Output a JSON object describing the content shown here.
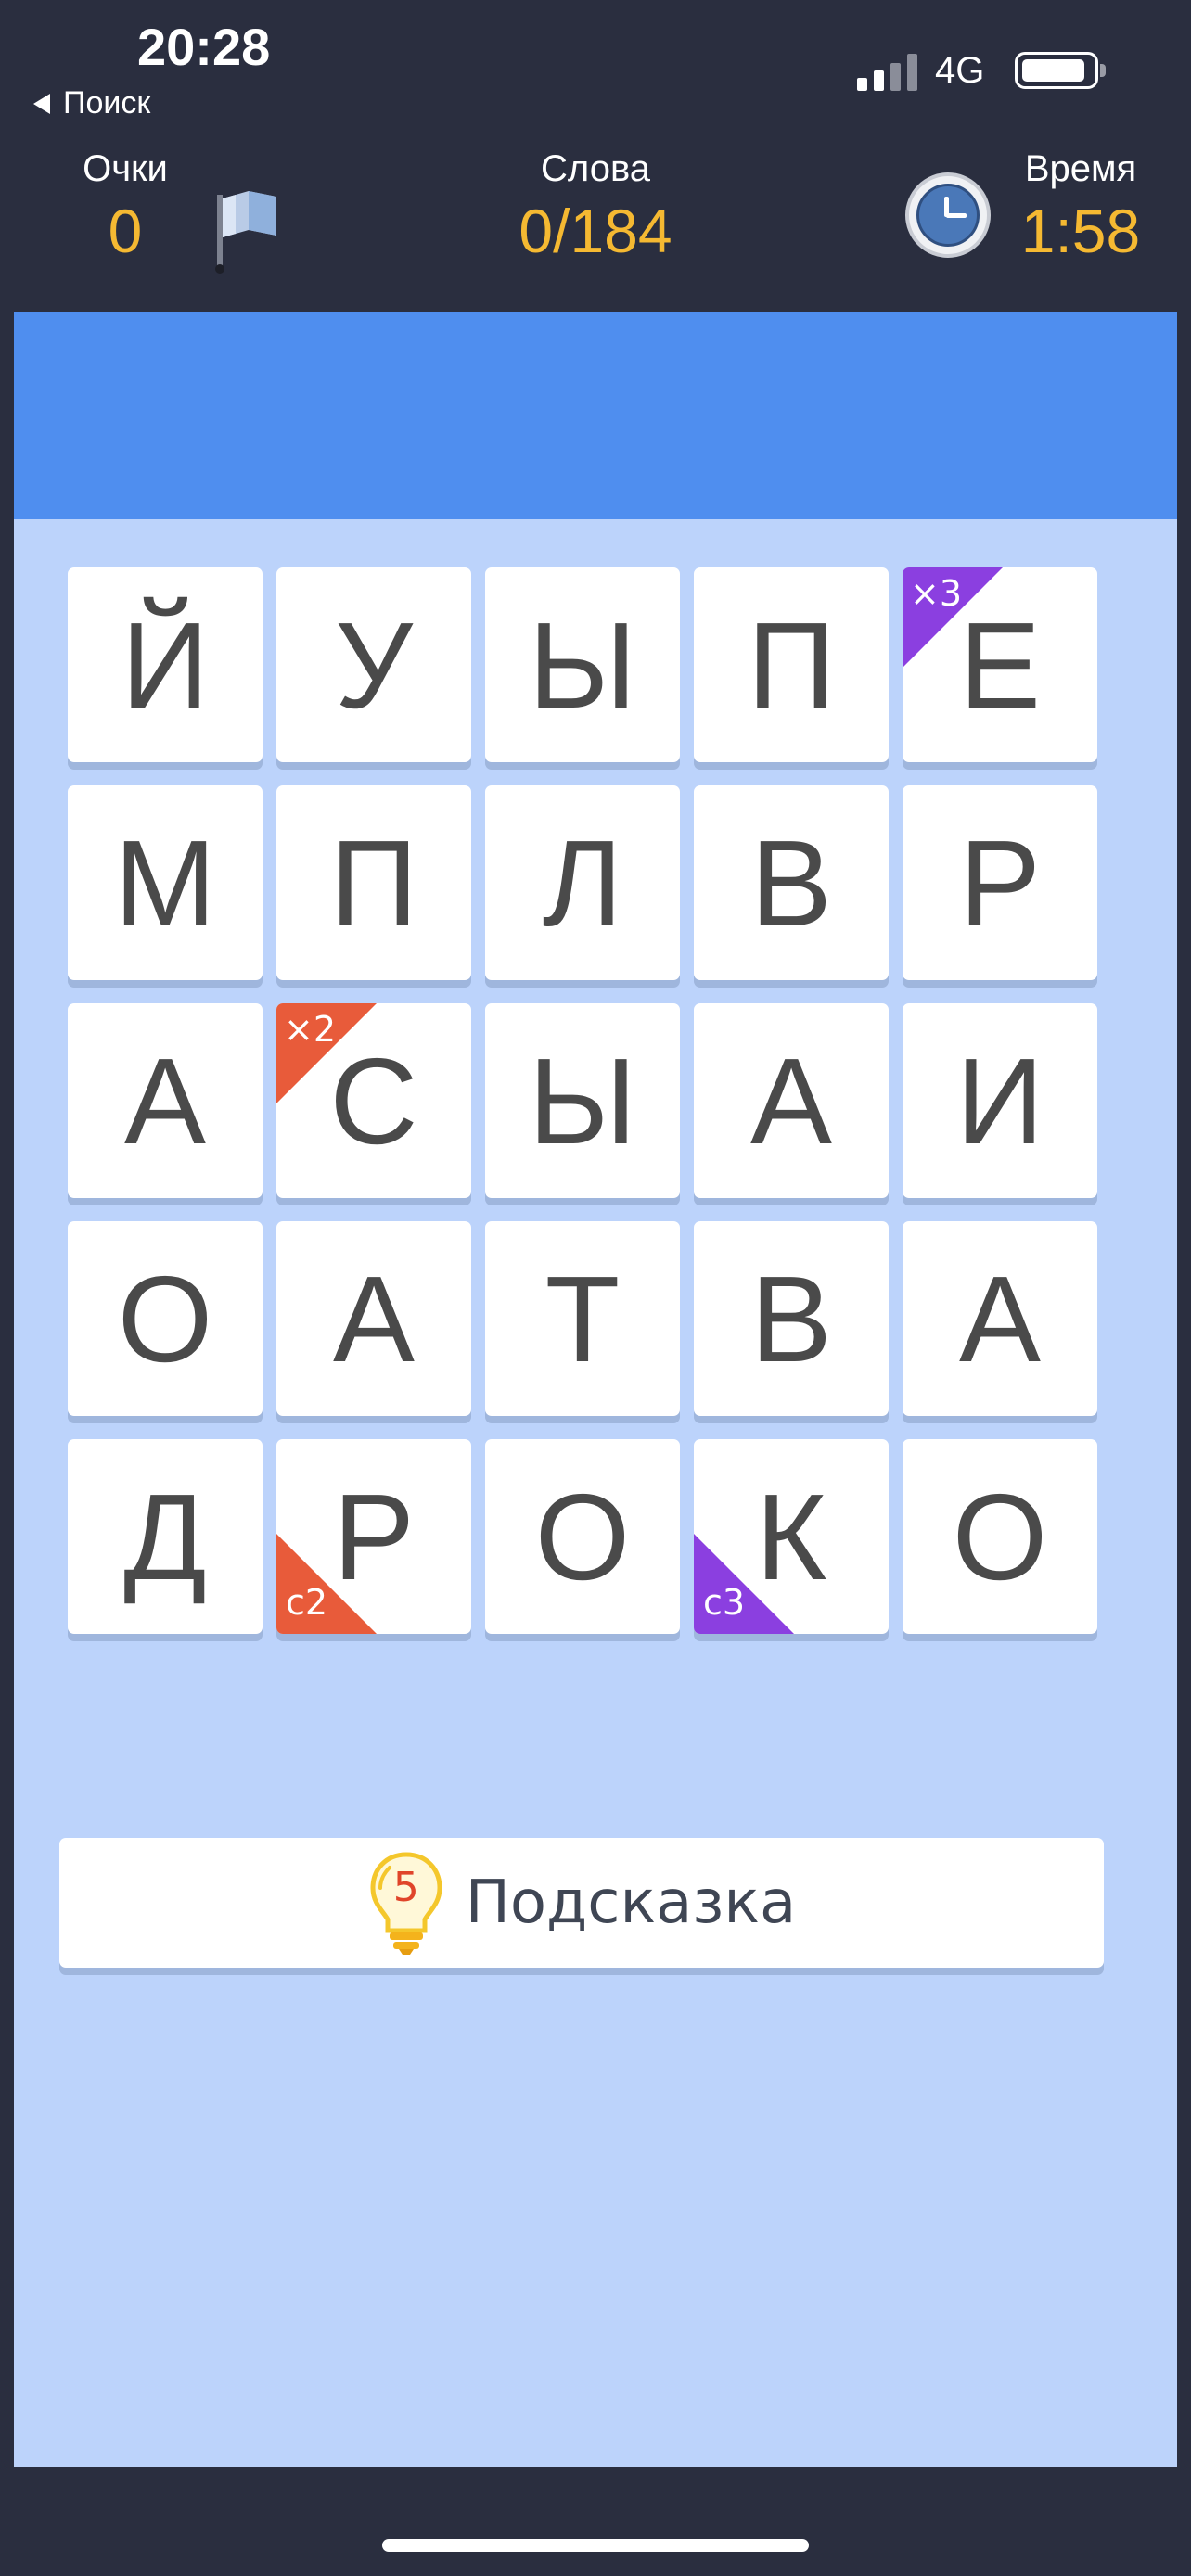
{
  "status_bar": {
    "time": "20:28",
    "back_label": "Поиск",
    "network": "4G"
  },
  "stats": {
    "score": {
      "label": "Очки",
      "value": "0"
    },
    "words": {
      "label": "Слова",
      "value": "0/184"
    },
    "time": {
      "label": "Время",
      "value": "1:58"
    }
  },
  "colors": {
    "accent_value": "#f5b932",
    "word_bar": "#4f8eef",
    "board_bg": "#bcd3fb",
    "bonus_red": "#e85b3a",
    "bonus_purple": "#8b3fe0"
  },
  "grid": {
    "rows": [
      [
        {
          "letter": "Й"
        },
        {
          "letter": "У"
        },
        {
          "letter": "Ы"
        },
        {
          "letter": "П"
        },
        {
          "letter": "Е",
          "badge": "×3",
          "badge_pos": "top-left",
          "badge_color": "purple"
        }
      ],
      [
        {
          "letter": "М"
        },
        {
          "letter": "П"
        },
        {
          "letter": "Л"
        },
        {
          "letter": "В"
        },
        {
          "letter": "Р"
        }
      ],
      [
        {
          "letter": "А"
        },
        {
          "letter": "С",
          "badge": "×2",
          "badge_pos": "top-left",
          "badge_color": "red"
        },
        {
          "letter": "Ы"
        },
        {
          "letter": "А"
        },
        {
          "letter": "И"
        }
      ],
      [
        {
          "letter": "О"
        },
        {
          "letter": "А"
        },
        {
          "letter": "Т"
        },
        {
          "letter": "В"
        },
        {
          "letter": "А"
        }
      ],
      [
        {
          "letter": "Д"
        },
        {
          "letter": "Р",
          "badge": "с2",
          "badge_pos": "bottom-left",
          "badge_color": "red"
        },
        {
          "letter": "О"
        },
        {
          "letter": "К",
          "badge": "с3",
          "badge_pos": "bottom-left",
          "badge_color": "purple"
        },
        {
          "letter": "О"
        }
      ]
    ]
  },
  "hint": {
    "count": "5",
    "label": "Подсказка",
    "icon": "lightbulb-icon"
  }
}
